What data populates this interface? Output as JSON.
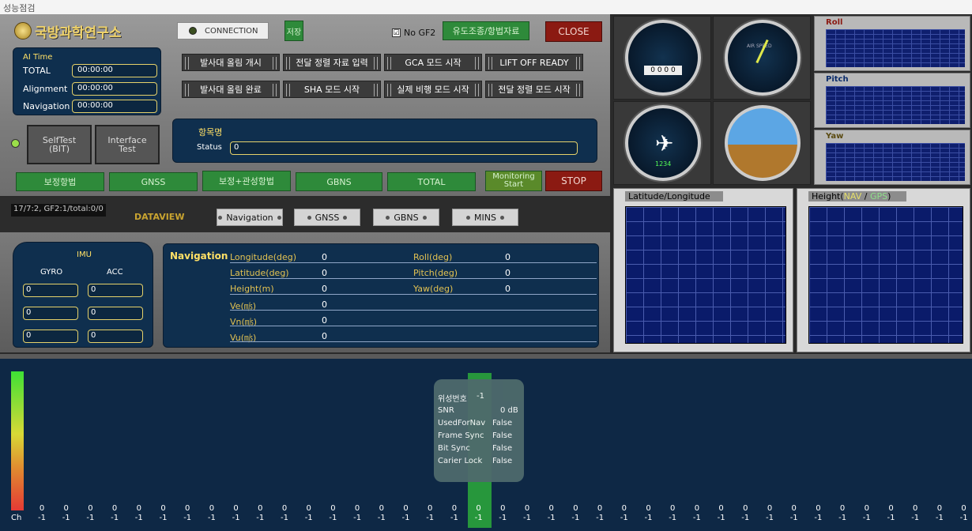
{
  "window": {
    "title": "성능점검"
  },
  "logo": {
    "text": "국방과학연구소"
  },
  "top": {
    "connection": "CONNECTION",
    "save": "저장",
    "no_gf2": "No GF2",
    "guide": "유도조종/항법자료",
    "close": "CLOSE",
    "check_mark": "☑"
  },
  "ai_time": {
    "title": "AI Time",
    "rows": [
      {
        "label": "TOTAL",
        "value": "00:00:00"
      },
      {
        "label": "Alignment",
        "value": "00:00:00"
      },
      {
        "label": "Navigation",
        "value": "00:00:00"
      }
    ]
  },
  "cmd_buttons": [
    "발사대 올림 개시",
    "전달 정렬 자료 입력",
    "GCA 모드 시작",
    "LIFT OFF READY",
    "발사대 올림 완료",
    "SHA 모드 시작",
    "실제 비행 모드 시작",
    "전달 정렬 모드 시작"
  ],
  "selftest": {
    "bit": "SelfTest\n(BIT)",
    "interface": "Interface\nTest"
  },
  "item": {
    "label": "항목명",
    "status_label": "Status",
    "status_value": "0"
  },
  "mode_buttons": [
    "보정항법",
    "GNSS",
    "보정+관성항법",
    "GBNS",
    "TOTAL"
  ],
  "monitoring": "Monitoring\nStart",
  "stop": "STOP",
  "dataview": {
    "status": "17/7:2, GF2:1/total:0/0",
    "label": "DATAVIEW",
    "tabs": [
      "Navigation",
      "GNSS",
      "GBNS",
      "MINS"
    ]
  },
  "imu": {
    "title": "IMU",
    "gyro": "GYRO",
    "acc": "ACC",
    "values": [
      [
        "0",
        "0"
      ],
      [
        "0",
        "0"
      ],
      [
        "0",
        "0"
      ]
    ]
  },
  "navigation": {
    "title": "Navigation",
    "rows": [
      {
        "label": "Longitude(deg)",
        "value": "0",
        "label2": "Roll(deg)",
        "value2": "0"
      },
      {
        "label": "Latitude(deg)",
        "value": "0",
        "label2": "Pitch(deg)",
        "value2": "0"
      },
      {
        "label": "Height(m)",
        "value": "0",
        "label2": "Yaw(deg)",
        "value2": "0"
      },
      {
        "label": "Ve(㎧)",
        "value": "0"
      },
      {
        "label": "Vn(㎧)",
        "value": "0"
      },
      {
        "label": "Vu(㎧)",
        "value": "0"
      }
    ]
  },
  "gauges": {
    "altimeter_digits": "0 0 0 0",
    "hdg_number": "1234",
    "airspeed": "AIR SPEED"
  },
  "rpy": [
    "Roll",
    "Pitch",
    "Yaw"
  ],
  "plots": {
    "latlon": "Latitude/Longitude",
    "height_prefix": "Height(",
    "nav": "NAV",
    "slash": " / ",
    "gps": "GPS",
    "height_suffix": ")"
  },
  "satellite": {
    "ch_label": "Ch",
    "top_vals": [
      "0",
      "0",
      "0",
      "0",
      "0",
      "0",
      "0",
      "0",
      "0",
      "0",
      "0",
      "0",
      "0",
      "0",
      "0",
      "0",
      "0",
      "0",
      "0",
      "0",
      "0",
      "0",
      "0",
      "0",
      "0",
      "0",
      "0",
      "0",
      "0",
      "0",
      "0",
      "0",
      "0",
      "0",
      "0",
      "0",
      "0",
      "0",
      "0"
    ],
    "bottom_vals": [
      "-1",
      "-1",
      "-1",
      "-1",
      "-1",
      "-1",
      "-1",
      "-1",
      "-1",
      "-1",
      "-1",
      "-1",
      "-1",
      "-1",
      "-1",
      "-1",
      "-1",
      "-1",
      "-1",
      "-1",
      "-1",
      "-1",
      "-1",
      "-1",
      "-1",
      "-1",
      "-1",
      "-1",
      "-1",
      "-1",
      "-1",
      "-1",
      "-1",
      "-1",
      "-1",
      "-1",
      "-1",
      "-1",
      "-1"
    ],
    "tooltip": [
      {
        "k": "위성번호",
        "v": "-1"
      },
      {
        "k": "SNR",
        "v": "0 dB"
      },
      {
        "k": "UsedForNav",
        "v": "False"
      },
      {
        "k": "Frame Sync",
        "v": "False"
      },
      {
        "k": "Bit Sync",
        "v": "False"
      },
      {
        "k": "Carier Lock",
        "v": "False"
      }
    ]
  },
  "colors": {
    "navy": "#0f2f4e",
    "green": "#2e8a3a",
    "red": "#8b1a12",
    "gold": "#e3c252"
  }
}
